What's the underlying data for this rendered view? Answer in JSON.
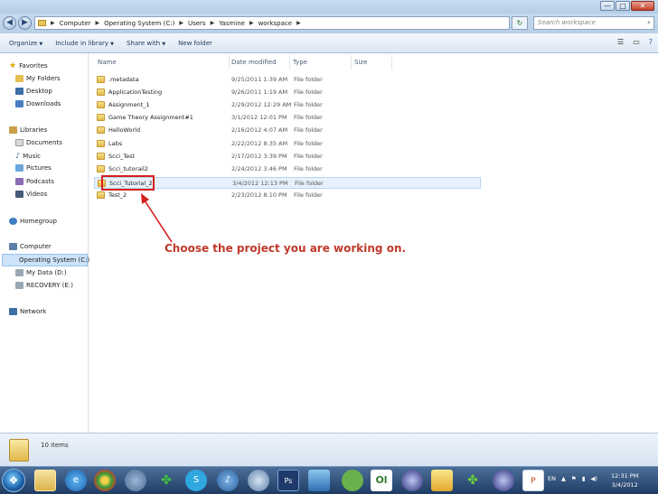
{
  "window": {
    "controls": {
      "minimize": "—",
      "maximize": "□",
      "close": "✕"
    }
  },
  "address": {
    "back_icon": "back-arrow-icon",
    "forward_icon": "forward-arrow-icon",
    "crumbs": [
      "Computer",
      "Operating System (C:)",
      "Users",
      "Yasmine",
      "workspace"
    ],
    "search_placeholder": "Search workspace"
  },
  "toolbar": {
    "organize": "Organize",
    "include_in_library": "Include in library",
    "share_with": "Share with",
    "new_folder": "New folder"
  },
  "nav": {
    "favorites": "Favorites",
    "my_folders": "My Folders",
    "desktop": "Desktop",
    "downloads": "Downloads",
    "libraries": "Libraries",
    "documents": "Documents",
    "music": "Music",
    "pictures": "Pictures",
    "podcasts": "Podcasts",
    "videos": "Videos",
    "homegroup": "Homegroup",
    "computer": "Computer",
    "os_c": "Operating System (C:)",
    "my_data_d": "My Data (D:)",
    "recovery_e": "RECOVERY (E:)",
    "network": "Network"
  },
  "columns": {
    "name": "Name",
    "date": "Date modified",
    "type": "Type",
    "size": "Size"
  },
  "files": [
    {
      "name": ".metadata",
      "date": "9/25/2011 1:39 AM",
      "type": "File folder"
    },
    {
      "name": "ApplicationTesting",
      "date": "9/26/2011 1:19 AM",
      "type": "File folder"
    },
    {
      "name": "Assignment_1",
      "date": "2/29/2012 12:29 AM",
      "type": "File folder"
    },
    {
      "name": "Game Theory Assignment#1",
      "date": "3/1/2012 12:01 PM",
      "type": "File folder"
    },
    {
      "name": "HelloWorld",
      "date": "2/16/2012 4:07 AM",
      "type": "File folder"
    },
    {
      "name": "Labs",
      "date": "2/22/2012 8:35 AM",
      "type": "File folder"
    },
    {
      "name": "Scci_Test",
      "date": "2/17/2012 3:39 PM",
      "type": "File folder"
    },
    {
      "name": "Scci_tutorail2",
      "date": "2/24/2012 3:46 PM",
      "type": "File folder"
    },
    {
      "name": "Scci_Tutorial_2",
      "date": "3/4/2012 12:13 PM",
      "type": "File folder"
    },
    {
      "name": "Test_2",
      "date": "2/23/2012 8:10 PM",
      "type": "File folder"
    }
  ],
  "annotation": "Choose the project you are working on.",
  "details": {
    "count": "10 items"
  },
  "taskbar": {
    "lang": "EN",
    "time": "12:31 PM",
    "date": "3/4/2012"
  }
}
